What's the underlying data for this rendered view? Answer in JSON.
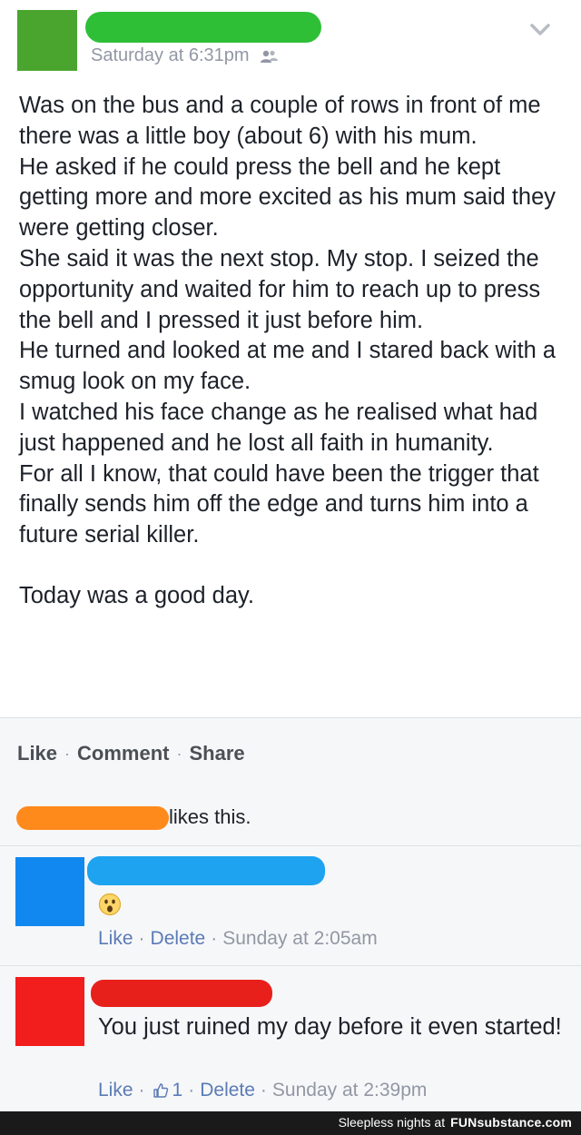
{
  "post": {
    "time": "Saturday at 6:31pm",
    "paragraphs": [
      "Was on the bus and a couple of rows in front of me there was a little boy (about 6) with his mum.",
      "He asked if he could press the bell and he kept getting more and more excited as his mum said they were getting closer.",
      "She said it was the next stop. My stop. I seized the opportunity and waited for him to reach up to press the bell and I pressed it just before him.",
      "He turned and looked at me and I stared back with a smug look on my face.",
      "I watched his face change as he realised what had just happened and he lost all faith in humanity.",
      "For all I know, that could have been the trigger that finally sends him off the edge and turns him into a future serial killer.",
      "Today was a good day."
    ],
    "icons": {
      "audience": "friends-icon",
      "menu": "chevron-down-icon"
    },
    "redactions": {
      "avatar": "#4aa52e",
      "name": "#2fbf37"
    }
  },
  "actions": {
    "like": "Like",
    "comment": "Comment",
    "share": "Share",
    "separator": "·"
  },
  "likes": {
    "suffix": "likes this.",
    "redaction": "#ff8a1c"
  },
  "comments": [
    {
      "emoji": "surprised-emoji-icon",
      "like_label": "Like",
      "delete_label": "Delete",
      "time": "Sunday at 2:05am",
      "redactions": {
        "avatar": "#1188f0",
        "name": "#1ea3f0"
      }
    },
    {
      "text": "You just ruined my day before it even started!",
      "like_label": "Like",
      "like_count": "1",
      "delete_label": "Delete",
      "time": "Sunday at 2:39pm",
      "redactions": {
        "avatar": "#f21d1d",
        "name": "#e8201c"
      }
    }
  ],
  "watermark": {
    "prefix": "Sleepless nights at",
    "brand": "FUNsubstance.com"
  }
}
